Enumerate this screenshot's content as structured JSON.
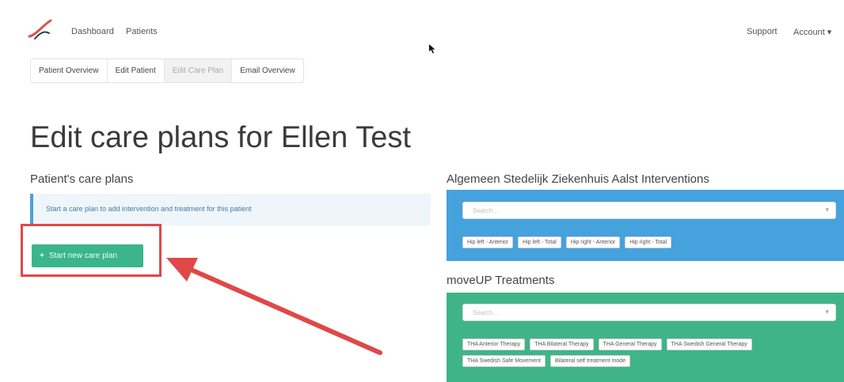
{
  "nav": {
    "dashboard": "Dashboard",
    "patients": "Patients",
    "support": "Support",
    "account": "Account ▾"
  },
  "tabs": [
    {
      "label": "Patient Overview",
      "active": false
    },
    {
      "label": "Edit Patient",
      "active": false
    },
    {
      "label": "Edit Care Plan",
      "active": true
    },
    {
      "label": "Email Overview",
      "active": false
    }
  ],
  "page_title": "Edit care plans for Ellen Test",
  "patient_care_plans": {
    "title": "Patient's care plans",
    "info": "Start a care plan to add intervention and treatment for this patient",
    "start_button": "Start new care plan"
  },
  "interventions": {
    "title": "Algemeen Stedelijk Ziekenhuis Aalst Interventions",
    "select_placeholder": "Search...",
    "tags": [
      "Hip left - Anterior",
      "Hip left - Total",
      "Hip right - Anterior",
      "Hip right - Total"
    ]
  },
  "treatments": {
    "title": "moveUP Treatments",
    "select_placeholder": "Search...",
    "tags": [
      "THA Anterior Therapy",
      "THA Bilateral Therapy",
      "THA General Therapy",
      "THA Swedish General Therapy",
      "THA Swedish Safe Movement",
      "Bilateral self treatment mode"
    ]
  },
  "colors": {
    "interventions_panel": "#45a2dc",
    "treatments_panel": "#3fb48a",
    "primary_button": "#3bb58c",
    "highlight": "#e04848"
  }
}
